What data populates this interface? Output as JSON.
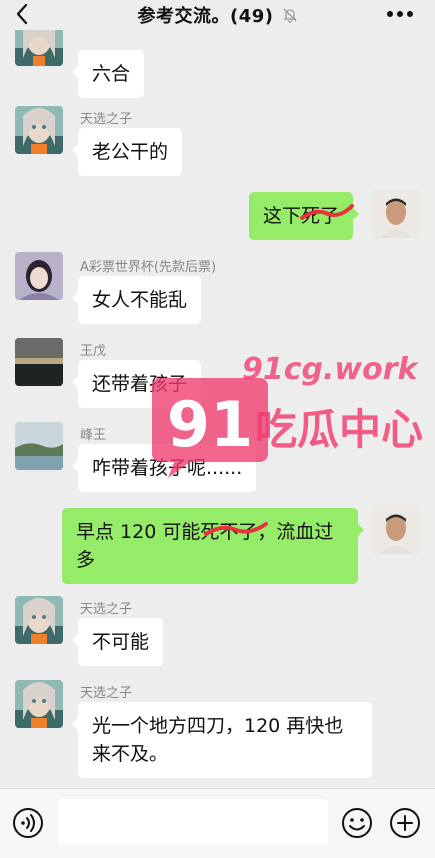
{
  "header": {
    "title": "参考交流。(49)"
  },
  "messages": [
    {
      "sender": "",
      "text": "六合",
      "side": "left"
    },
    {
      "sender": "天选之子",
      "text": "老公干的",
      "side": "left"
    },
    {
      "sender": "",
      "text": "这下死了",
      "side": "right"
    },
    {
      "sender": "A彩票世界杯(先款后票)",
      "text": "女人不能乱",
      "side": "left"
    },
    {
      "sender": "王戊",
      "text": "还带着孩子",
      "side": "left"
    },
    {
      "sender": "峰王",
      "text": "咋带着孩子呢......",
      "side": "left"
    },
    {
      "sender": "",
      "text_line1": "早点 120 可能死不了，流血过",
      "text_line2": "多",
      "side": "right"
    },
    {
      "sender": "天选之子",
      "text": "不可能",
      "side": "left"
    },
    {
      "sender": "天选之子",
      "text_line1": "光一个地方四刀，120 再快也",
      "text_line2": "来不及。",
      "side": "left"
    }
  ],
  "watermark": {
    "badge": "91",
    "url": "91cg.work",
    "name": "吃瓜中心"
  },
  "input": {
    "value": "",
    "placeholder": ""
  },
  "icons": {
    "back": "back-chevron-icon",
    "mute": "bell-muted-icon",
    "more": "more-dots-icon",
    "voice": "voice-icon",
    "emoji": "emoji-icon",
    "plus": "plus-icon"
  },
  "colors": {
    "background": "#ededed",
    "bubble_white": "#ffffff",
    "bubble_green": "#95ec69",
    "watermark": "#f03c6e",
    "scribble": "#e8323c"
  }
}
